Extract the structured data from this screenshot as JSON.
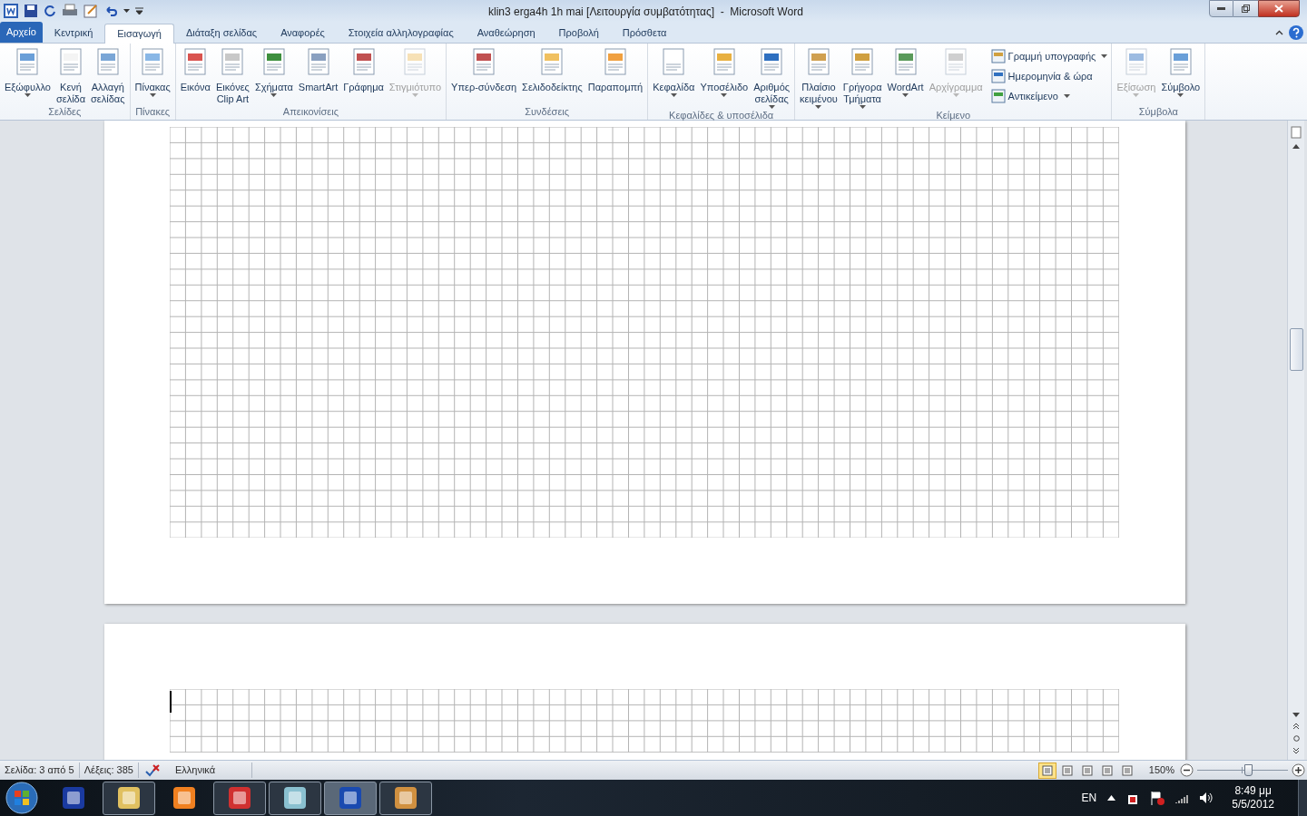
{
  "window": {
    "title": "klin3 erga4h 1h mai [Λειτουργία συμβατότητας]  -  Microsoft Word"
  },
  "tabs": [
    {
      "label": "Αρχείο",
      "kind": "file",
      "selected": false
    },
    {
      "label": "Κεντρική",
      "kind": "tab",
      "selected": false
    },
    {
      "label": "Εισαγωγή",
      "kind": "tab",
      "selected": true
    },
    {
      "label": "Διάταξη σελίδας",
      "kind": "tab",
      "selected": false
    },
    {
      "label": "Αναφορές",
      "kind": "tab",
      "selected": false
    },
    {
      "label": "Στοιχεία αλληλογραφίας",
      "kind": "tab",
      "selected": false
    },
    {
      "label": "Αναθεώρηση",
      "kind": "tab",
      "selected": false
    },
    {
      "label": "Προβολή",
      "kind": "tab",
      "selected": false
    },
    {
      "label": "Πρόσθετα",
      "kind": "tab",
      "selected": false
    }
  ],
  "ribbon": [
    {
      "label": "Σελίδες",
      "buttons": [
        {
          "kind": "large",
          "lines": [
            "Εξώφυλλο"
          ],
          "dropdown": true,
          "disabled": false
        },
        {
          "kind": "large",
          "lines": [
            "Κενή",
            "σελίδα"
          ],
          "dropdown": false,
          "disabled": false
        },
        {
          "kind": "large",
          "lines": [
            "Αλλαγή",
            "σελίδας"
          ],
          "dropdown": false,
          "disabled": false
        }
      ]
    },
    {
      "label": "Πίνακες",
      "buttons": [
        {
          "kind": "large",
          "lines": [
            "Πίνακας"
          ],
          "dropdown": true,
          "disabled": false
        }
      ]
    },
    {
      "label": "Απεικονίσεις",
      "buttons": [
        {
          "kind": "large",
          "lines": [
            "Εικόνα"
          ],
          "dropdown": false,
          "disabled": false
        },
        {
          "kind": "large",
          "lines": [
            "Εικόνες",
            "Clip Art"
          ],
          "dropdown": false,
          "disabled": false
        },
        {
          "kind": "large",
          "lines": [
            "Σχήματα"
          ],
          "dropdown": true,
          "disabled": false
        },
        {
          "kind": "large",
          "lines": [
            "SmartArt"
          ],
          "dropdown": false,
          "disabled": false
        },
        {
          "kind": "large",
          "lines": [
            "Γράφημα"
          ],
          "dropdown": false,
          "disabled": false
        },
        {
          "kind": "large",
          "lines": [
            "Στιγμιότυπο"
          ],
          "dropdown": true,
          "disabled": true
        }
      ]
    },
    {
      "label": "Συνδέσεις",
      "buttons": [
        {
          "kind": "large",
          "lines": [
            "Υπερ-σύνδεση"
          ],
          "dropdown": false,
          "disabled": false
        },
        {
          "kind": "large",
          "lines": [
            "Σελιδοδείκτης"
          ],
          "dropdown": false,
          "disabled": false
        },
        {
          "kind": "large",
          "lines": [
            "Παραπομπή"
          ],
          "dropdown": false,
          "disabled": false
        }
      ]
    },
    {
      "label": "Κεφαλίδες & υποσέλιδα",
      "buttons": [
        {
          "kind": "large",
          "lines": [
            "Κεφαλίδα"
          ],
          "dropdown": true,
          "disabled": false
        },
        {
          "kind": "large",
          "lines": [
            "Υποσέλιδο"
          ],
          "dropdown": true,
          "disabled": false
        },
        {
          "kind": "large",
          "lines": [
            "Αριθμός",
            "σελίδας"
          ],
          "dropdown": true,
          "disabled": false
        }
      ]
    },
    {
      "label": "Κείμενο",
      "buttons": [
        {
          "kind": "large",
          "lines": [
            "Πλαίσιο",
            "κειμένου"
          ],
          "dropdown": true,
          "disabled": false
        },
        {
          "kind": "large",
          "lines": [
            "Γρήγορα",
            "Τμήματα"
          ],
          "dropdown": true,
          "disabled": false
        },
        {
          "kind": "large",
          "lines": [
            "WordArt"
          ],
          "dropdown": true,
          "disabled": false
        },
        {
          "kind": "large",
          "lines": [
            "Αρχίγραμμα"
          ],
          "dropdown": true,
          "disabled": true
        },
        {
          "kind": "small",
          "lines": [
            "Γραμμή υπογραφής"
          ],
          "dropdown": true,
          "disabled": false
        },
        {
          "kind": "small",
          "lines": [
            "Ημερομηνία & ώρα"
          ],
          "dropdown": false,
          "disabled": false
        },
        {
          "kind": "small",
          "lines": [
            "Αντικείμενο"
          ],
          "dropdown": true,
          "disabled": false
        }
      ]
    },
    {
      "label": "Σύμβολα",
      "buttons": [
        {
          "kind": "large",
          "lines": [
            "Εξίσωση"
          ],
          "dropdown": true,
          "disabled": true
        },
        {
          "kind": "large",
          "lines": [
            "Σύμβολο"
          ],
          "dropdown": true,
          "disabled": false
        }
      ]
    }
  ],
  "status_bar": {
    "page": "Σελίδα: 3 από 5",
    "words": "Λέξεις: 385",
    "language": "Ελληνικά",
    "views": [
      {
        "selected": true
      },
      {
        "selected": false
      },
      {
        "selected": false
      },
      {
        "selected": false
      },
      {
        "selected": false
      }
    ],
    "zoom": "150%",
    "zoom_slider": {
      "level": 0.57
    }
  },
  "taskbar": {
    "apps": [
      {
        "running": false,
        "selected": false
      },
      {
        "running": true,
        "selected": false
      },
      {
        "running": false,
        "selected": false
      },
      {
        "running": true,
        "selected": false
      },
      {
        "running": true,
        "selected": false
      },
      {
        "running": true,
        "selected": true
      },
      {
        "running": true,
        "selected": false
      }
    ],
    "language": "EN",
    "time": "8:49 μμ",
    "date": "5/5/2012"
  }
}
